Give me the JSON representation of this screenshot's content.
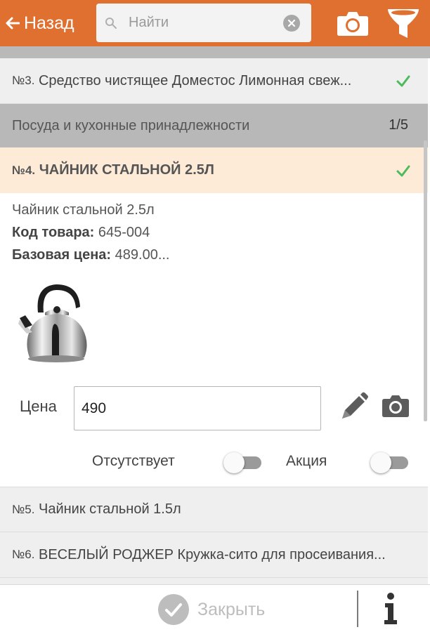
{
  "header": {
    "back_label": "Назад",
    "search_placeholder": "Найти"
  },
  "list": {
    "items": [
      {
        "num": "№3.",
        "text": "Средство чистящее Доместос Лимонная свеж...",
        "checked": true
      },
      {
        "category": "Посуда и кухонные принадлежности",
        "count": "1/5"
      },
      {
        "num": "№4.",
        "text": "ЧАЙНИК СТАЛЬНОЙ 2.5Л",
        "checked": true,
        "selected": true
      },
      {
        "num": "№5.",
        "text": "Чайник стальной 1.5л",
        "checked": false
      },
      {
        "num": "№6.",
        "text": "ВЕСЕЛЫЙ РОДЖЕР Кружка-сито для просеивания...",
        "checked": false
      }
    ]
  },
  "detail": {
    "name": "Чайник стальной 2.5л",
    "code_label": "Код товара:",
    "code_value": "645-004",
    "base_price_label": "Базовая цена:",
    "base_price_value": "489.00...",
    "image_icon": "kettle-image",
    "price_label": "Цена",
    "price_value": "490",
    "absent_label": "Отсутствует",
    "absent_on": false,
    "promo_label": "Акция",
    "promo_on": false
  },
  "footer": {
    "close_label": "Закрыть",
    "info_icon": "info-icon"
  },
  "colors": {
    "accent": "#e0702f",
    "check": "#4cbb5b",
    "selected_row": "#fdebd8",
    "category_row": "#b8b8b8",
    "light_row": "#efefef"
  }
}
